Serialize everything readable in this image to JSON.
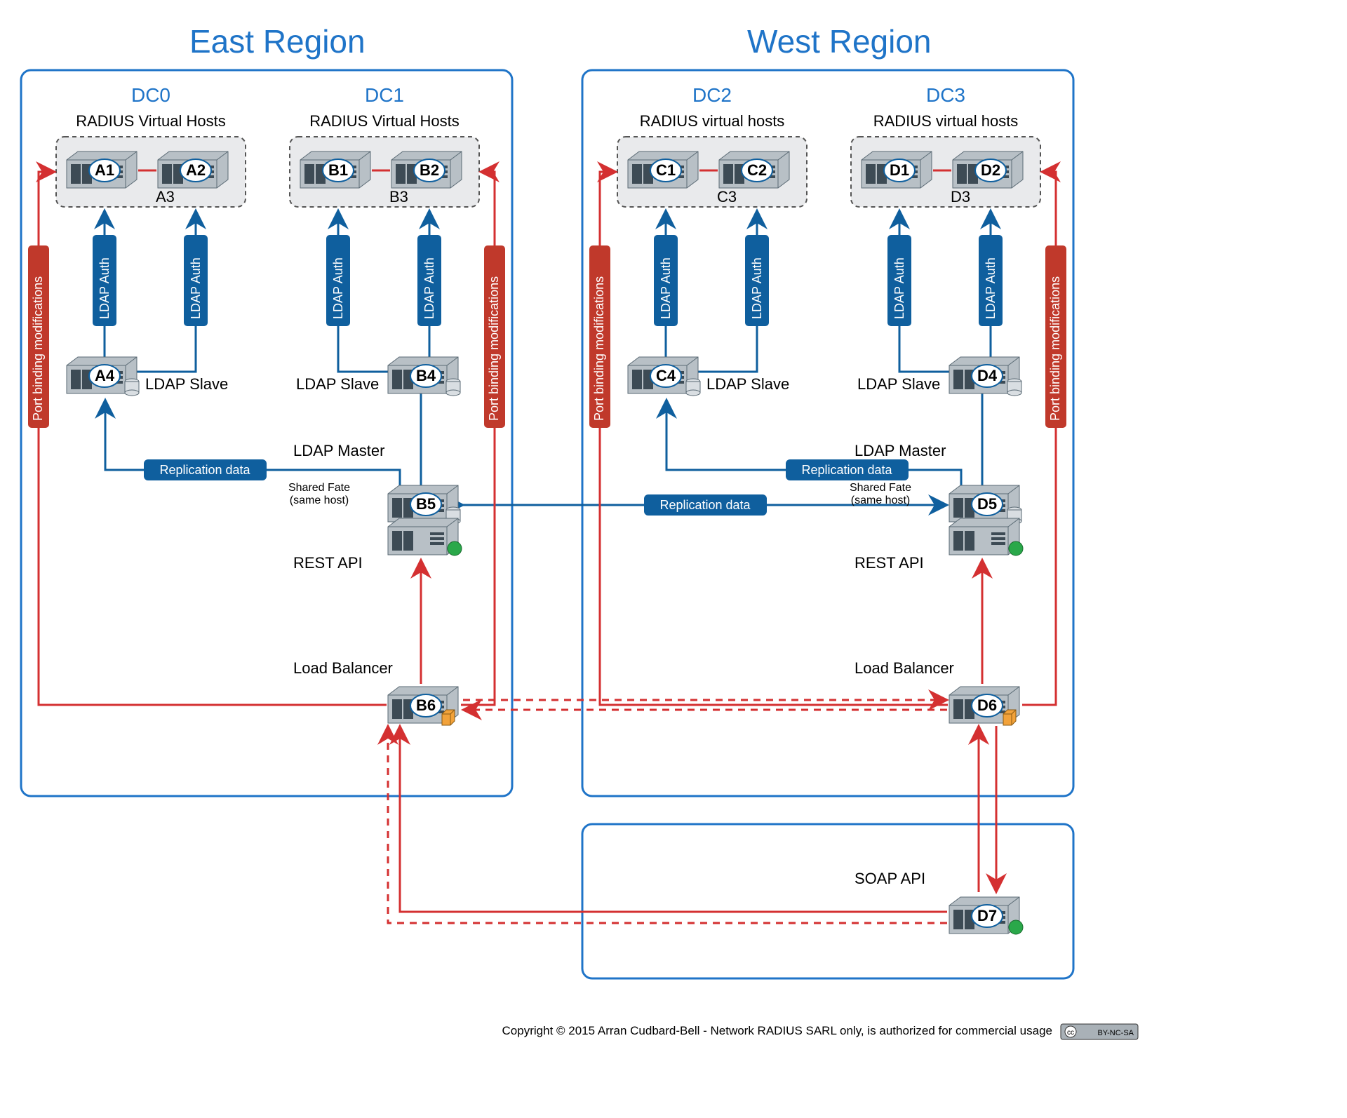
{
  "titles": {
    "east": "East Region",
    "west": "West Region"
  },
  "dcs": {
    "dc0": "DC0",
    "dc1": "DC1",
    "dc2": "DC2",
    "dc3": "DC3"
  },
  "radiusHeader": {
    "east": "RADIUS Virtual Hosts",
    "west": "RADIUS virtual hosts"
  },
  "nodes": {
    "A1": "A1",
    "A2": "A2",
    "A3": "A3",
    "A4": "A4",
    "B1": "B1",
    "B2": "B2",
    "B3": "B3",
    "B4": "B4",
    "B5": "B5",
    "B6": "B6",
    "C1": "C1",
    "C2": "C2",
    "C3": "C3",
    "C4": "C4",
    "D1": "D1",
    "D2": "D2",
    "D3": "D3",
    "D4": "D4",
    "D5": "D5",
    "D6": "D6",
    "D7": "D7"
  },
  "labels": {
    "ldapAuth": "LDAP Auth",
    "ldapSlave": "LDAP Slave",
    "ldapMaster": "LDAP Master",
    "replication": "Replication data",
    "sharedFate1": "Shared Fate",
    "sharedFate2": "(same host)",
    "restApi": "REST API",
    "loadBalancer": "Load Balancer",
    "soapApi": "SOAP API",
    "portBinding": "Port binding modifications"
  },
  "footer": {
    "copyright": "Copyright © 2015 Arran Cudbard-Bell - Network RADIUS SARL only, is authorized for commercial usage",
    "cc": "BY-NC-SA"
  }
}
